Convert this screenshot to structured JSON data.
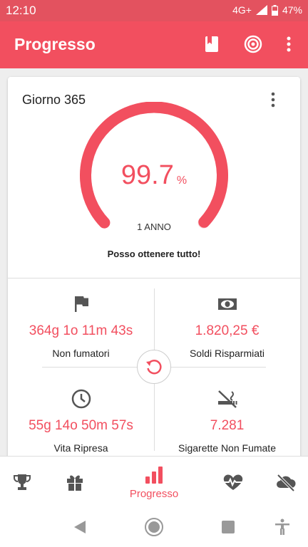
{
  "status": {
    "time": "12:10",
    "network": "4G+",
    "battery": "47%"
  },
  "appbar": {
    "title": "Progresso",
    "icons": [
      "book-icon",
      "target-icon",
      "more-icon"
    ]
  },
  "card": {
    "day": "Giorno 365",
    "percent": "99.7",
    "percent_unit": "%",
    "progress_fraction": 0.997,
    "period": "1 ANNO",
    "motto": "Posso ottenere tutto!"
  },
  "stats": [
    {
      "icon": "flag-icon",
      "value": "364g 1o 11m 43s",
      "label": "Non fumatori"
    },
    {
      "icon": "money-icon",
      "value": "1.820,25 €",
      "label": "Soldi Risparmiati"
    },
    {
      "icon": "clock-icon",
      "value": "55g 14o 50m 57s",
      "label": "Vita Ripresa"
    },
    {
      "icon": "no-smoking-icon",
      "value": "7.281",
      "label": "Sigarette Non Fumate"
    }
  ],
  "bottom_nav": {
    "active_label": "Progresso",
    "items": [
      "trophy-icon",
      "gift-icon",
      "progress-bars-icon",
      "heartbeat-icon",
      "no-cloud-icon"
    ]
  },
  "colors": {
    "accent": "#f24f5f",
    "status_bar": "#e3525f",
    "icon_gray": "#555555"
  }
}
